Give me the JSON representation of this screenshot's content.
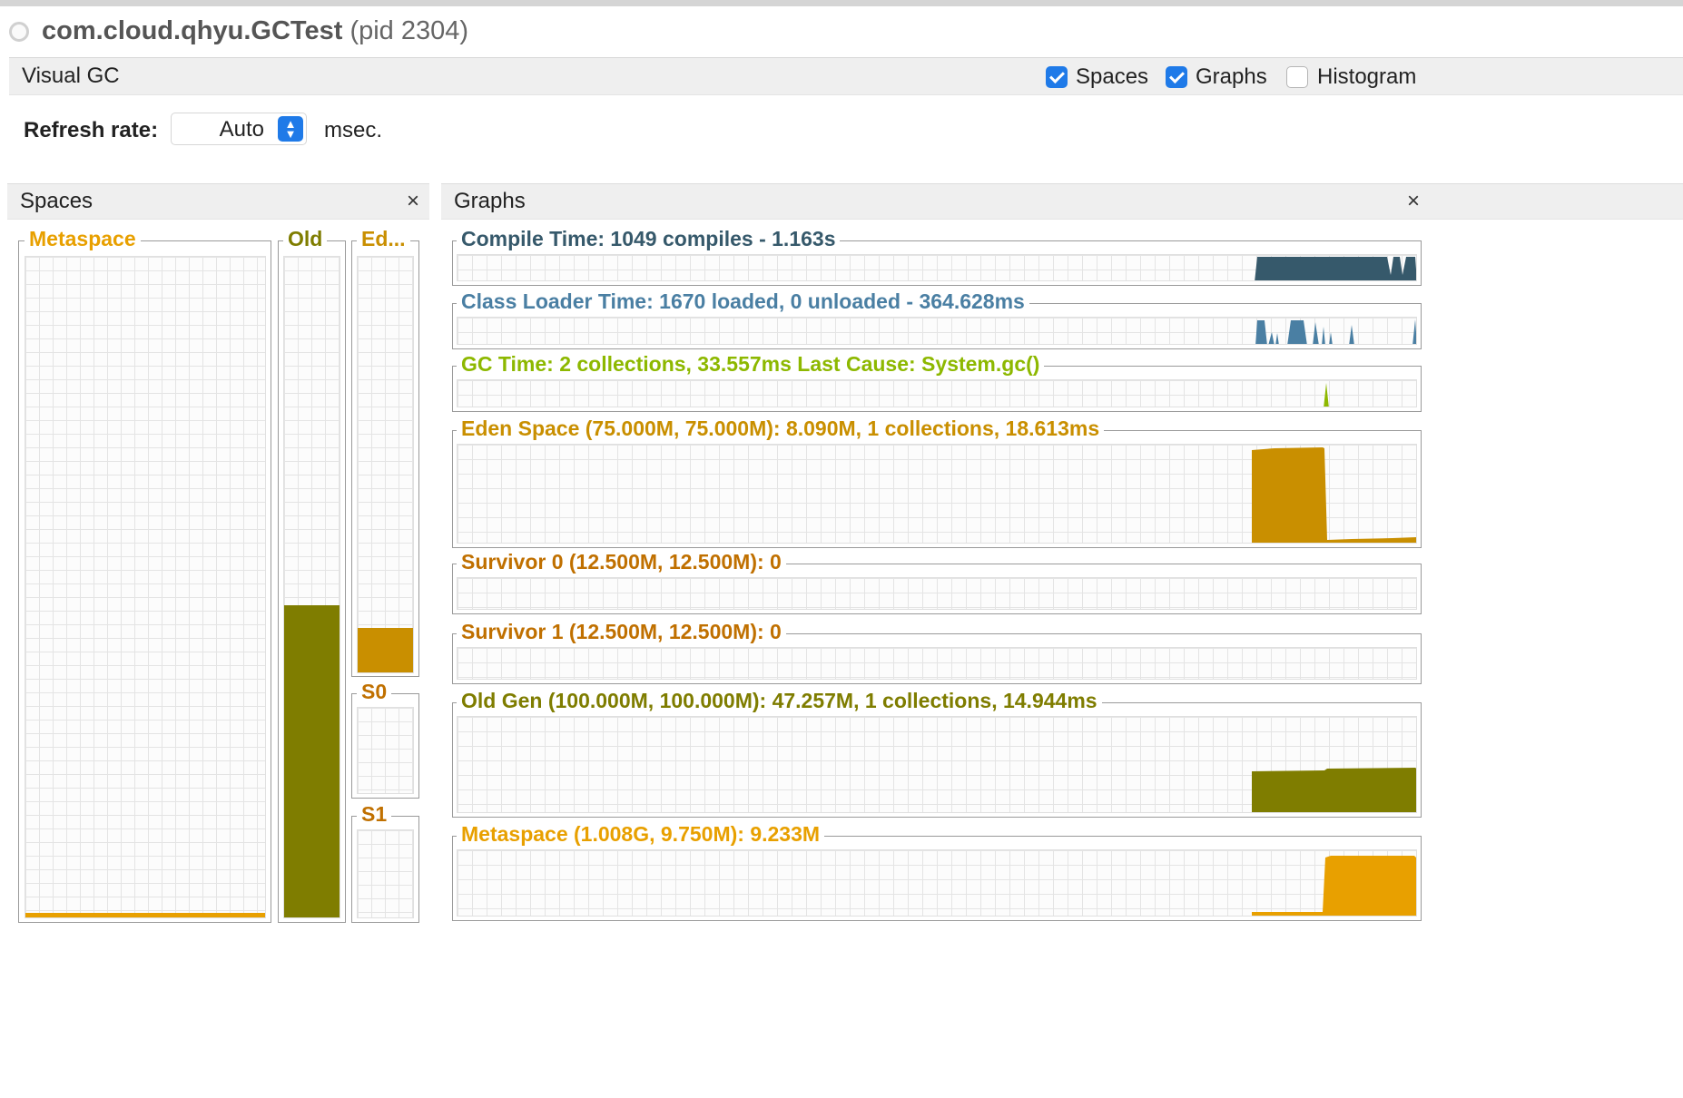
{
  "app": {
    "process_name": "com.cloud.qhyu.GCTest",
    "process_pid": "(pid 2304)"
  },
  "visual_gc": {
    "title": "Visual GC",
    "options": [
      {
        "label": "Spaces",
        "checked": true
      },
      {
        "label": "Graphs",
        "checked": true
      },
      {
        "label": "Histogram",
        "checked": false
      }
    ],
    "refresh_label": "Refresh rate:",
    "refresh_value": "Auto",
    "refresh_unit": "msec."
  },
  "spaces_panel": {
    "title": "Spaces",
    "close": "×",
    "metaspace": {
      "label": "Metaspace",
      "fill_fraction": 0.004,
      "color": "#e8a000"
    },
    "old": {
      "label": "Old",
      "fill_fraction": 0.4726,
      "color": "#7f7d00"
    },
    "eden": {
      "label": "Ed...",
      "fill_fraction": 0.108,
      "color": "#c98f00"
    },
    "s0": {
      "label": "S0",
      "fill_fraction": 0
    },
    "s1": {
      "label": "S1",
      "fill_fraction": 0
    }
  },
  "graphs_panel": {
    "title": "Graphs",
    "close": "×",
    "graphs": [
      {
        "id": "compile",
        "label": "Compile Time: 1049 compiles - 1.163s",
        "color": "#36596b"
      },
      {
        "id": "classloader",
        "label": "Class Loader Time: 1670 loaded, 0 unloaded - 364.628ms",
        "color": "#4a7fa3"
      },
      {
        "id": "gc",
        "label": "GC Time: 2 collections, 33.557ms Last Cause: System.gc()",
        "color": "#8db800"
      },
      {
        "id": "eden",
        "label": "Eden Space (75.000M, 75.000M): 8.090M, 1 collections, 18.613ms",
        "color": "#c98f00"
      },
      {
        "id": "s0",
        "label": "Survivor 0 (12.500M, 12.500M): 0",
        "color": "#c07000"
      },
      {
        "id": "s1",
        "label": "Survivor 1 (12.500M, 12.500M): 0",
        "color": "#c07000"
      },
      {
        "id": "old",
        "label": "Old Gen (100.000M, 100.000M): 47.257M, 1 collections, 14.944ms",
        "color": "#7f7d00"
      },
      {
        "id": "meta",
        "label": "Metaspace (1.008G, 9.750M): 9.233M",
        "color": "#e8a000"
      }
    ]
  }
}
